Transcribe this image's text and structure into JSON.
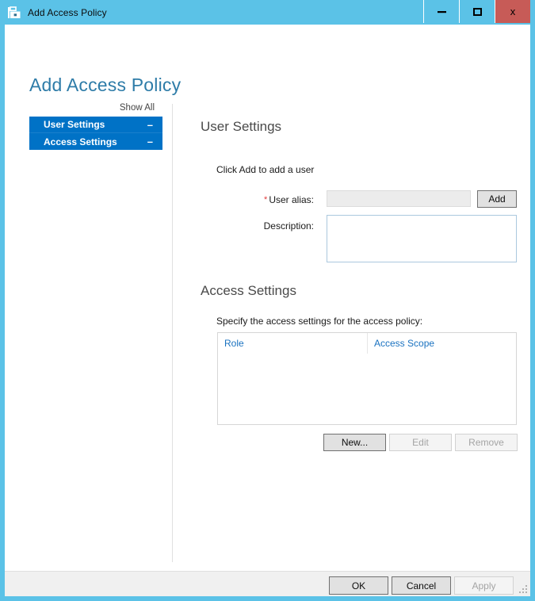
{
  "window": {
    "title": "Add Access Policy",
    "icon": "policy-toolbox-icon",
    "border_color": "#5bc2e7",
    "caption": {
      "minimize_label": "–",
      "maximize_label": "❑",
      "close_label": "x",
      "close_color": "#c75b57"
    }
  },
  "page": {
    "title": "Add Access Policy",
    "title_color": "#2e7ca8"
  },
  "nav": {
    "show_all_label": "Show All",
    "accent_color": "#0072c6",
    "items": [
      {
        "label": "User Settings",
        "toggle": "–"
      },
      {
        "label": "Access Settings",
        "toggle": "–"
      }
    ]
  },
  "user_settings": {
    "heading": "User Settings",
    "hint": "Click Add to add a user",
    "alias_label": "User alias:",
    "alias_required": "*",
    "alias_value": "",
    "alias_placeholder": "",
    "add_button": "Add",
    "description_label": "Description:",
    "description_value": "",
    "description_placeholder": ""
  },
  "access_settings": {
    "heading": "Access Settings",
    "hint": "Specify the access settings for the access policy:",
    "table": {
      "columns": [
        "Role",
        "Access Scope"
      ],
      "rows": [],
      "header_color": "#1a72c0"
    },
    "buttons": {
      "new_label": "New...",
      "edit_label": "Edit",
      "remove_label": "Remove"
    }
  },
  "footer": {
    "ok_label": "OK",
    "cancel_label": "Cancel",
    "apply_label": "Apply"
  }
}
